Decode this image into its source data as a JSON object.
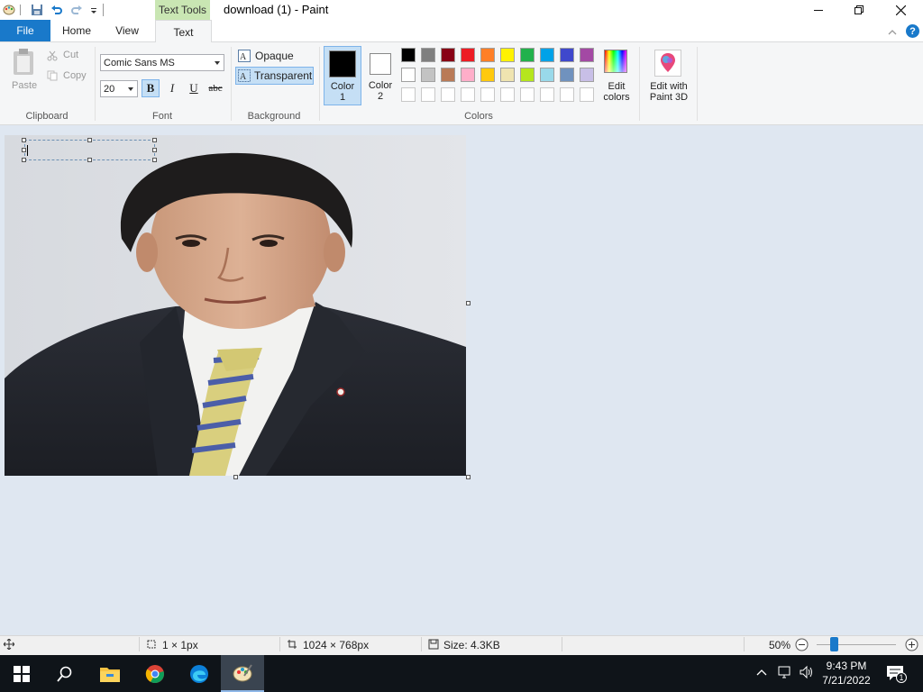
{
  "window": {
    "title": "download (1) - Paint",
    "context_tab_header": "Text Tools"
  },
  "tabs": {
    "file": "File",
    "home": "Home",
    "view": "View",
    "text": "Text"
  },
  "ribbon": {
    "clipboard": {
      "paste": "Paste",
      "cut": "Cut",
      "copy": "Copy",
      "label": "Clipboard"
    },
    "font": {
      "family": "Comic Sans MS",
      "size": "20",
      "bold": "B",
      "italic": "I",
      "underline": "U",
      "strikethrough": "abc",
      "label": "Font"
    },
    "background": {
      "opaque": "Opaque",
      "transparent": "Transparent",
      "label": "Background"
    },
    "colors": {
      "color1_line1": "Color",
      "color1_line2": "1",
      "color2_line1": "Color",
      "color2_line2": "2",
      "color1_value": "#000000",
      "color2_value": "#ffffff",
      "palette_row1": [
        "#000000",
        "#7f7f7f",
        "#880015",
        "#ed1c24",
        "#ff7f27",
        "#fff200",
        "#22b14c",
        "#00a2e8",
        "#3f48cc",
        "#a349a4"
      ],
      "palette_row2": [
        "#ffffff",
        "#c3c3c3",
        "#b97a57",
        "#ffaec9",
        "#ffc90e",
        "#efe4b0",
        "#b5e61d",
        "#99d9ea",
        "#7092be",
        "#c8bfe7"
      ],
      "edit_colors_line1": "Edit",
      "edit_colors_line2": "colors",
      "label": "Colors"
    },
    "paint3d": {
      "line1": "Edit with",
      "line2": "Paint 3D"
    }
  },
  "status": {
    "selection": "1 × 1px",
    "image_size": "1024 × 768px",
    "file_size": "Size: 4.3KB",
    "zoom": "50%",
    "zoom_level": 0.5
  },
  "taskbar": {
    "time": "9:43 PM",
    "date": "7/21/2022",
    "notification_count": "1"
  },
  "icons": {
    "paint": "paint-app-icon",
    "save": "save-icon",
    "undo": "undo-icon",
    "redo": "redo-icon",
    "search": "search-icon",
    "explorer": "file-explorer-icon",
    "chrome": "chrome-icon",
    "edge": "edge-icon"
  },
  "accent": "#1979ca"
}
